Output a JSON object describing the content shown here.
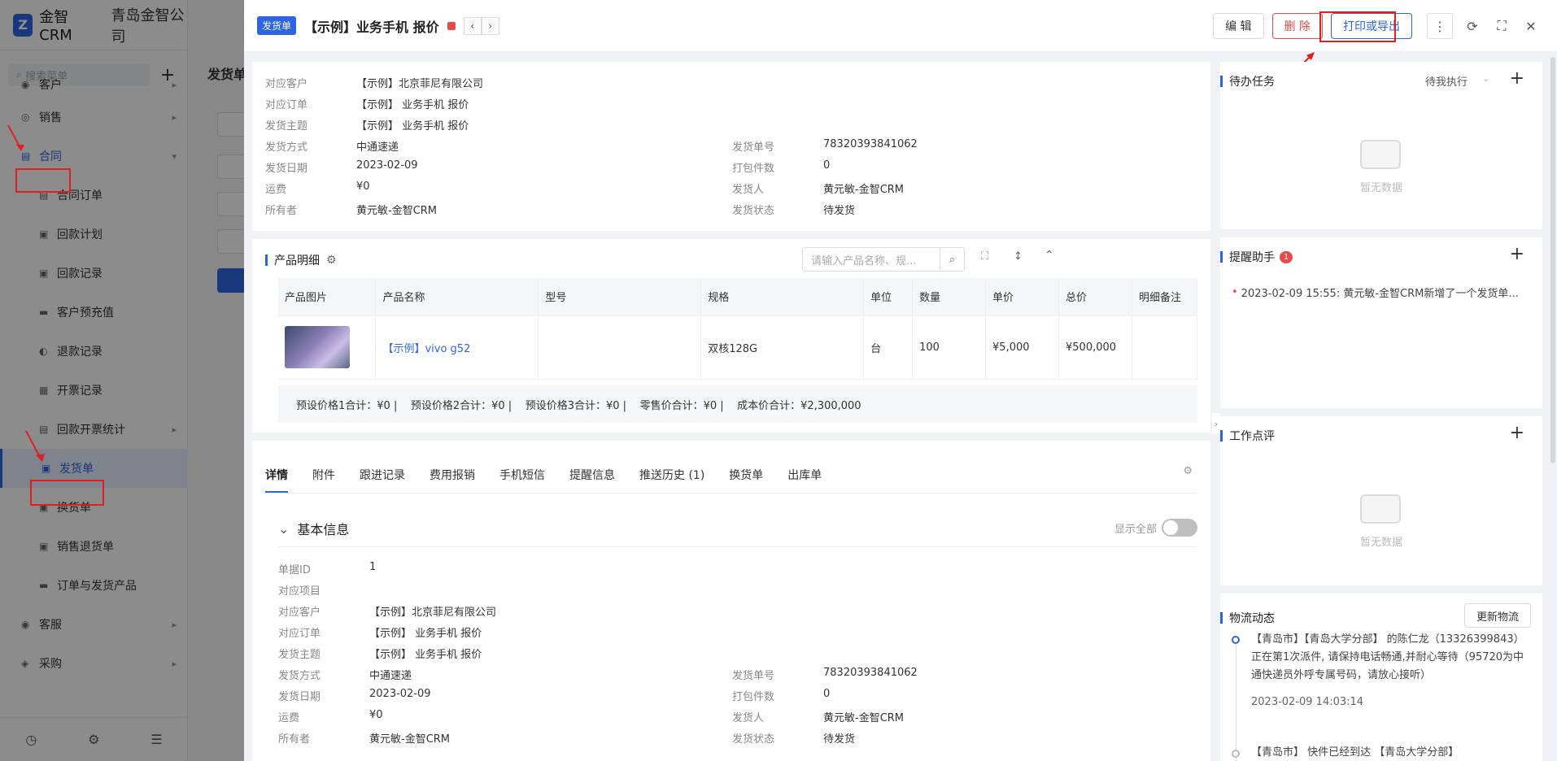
{
  "app": {
    "logo_text": "金智CRM",
    "logo_mark": "Z",
    "company": "青岛金智公司",
    "search_placeholder": "搜索菜单",
    "plus": "+",
    "bg_title": "发货单",
    "nav": [
      {
        "label": "客户"
      },
      {
        "label": "销售"
      },
      {
        "label": "合同"
      },
      {
        "label": "合同订单"
      },
      {
        "label": "回款计划"
      },
      {
        "label": "回款记录"
      },
      {
        "label": "客户预充值"
      },
      {
        "label": "退款记录"
      },
      {
        "label": "开票记录"
      },
      {
        "label": "回款开票统计"
      },
      {
        "label": "发货单"
      },
      {
        "label": "换货单"
      },
      {
        "label": "销售退货单"
      },
      {
        "label": "订单与发货产品"
      },
      {
        "label": "客服"
      },
      {
        "label": "采购"
      }
    ]
  },
  "drawer": {
    "tag": "发货单",
    "title": "【示例】业务手机 报价",
    "edit_label": "编 辑",
    "delete_label": "删 除",
    "print_label": "打印或导出",
    "summary": {
      "customer_label": "对应客户",
      "customer_value": "【示例】北京菲尼有限公司",
      "order_label": "对应订单",
      "order_value": "【示例】 业务手机 报价",
      "subject_label": "发货主题",
      "subject_value": "【示例】 业务手机 报价",
      "method_label": "发货方式",
      "method_value": "中通速递",
      "date_label": "发货日期",
      "date_value": "2023-02-09",
      "freight_label": "运费",
      "freight_value": "¥0",
      "owner_label": "所有者",
      "owner_value": "黄元敏-金智CRM",
      "no_label": "发货单号",
      "no_value": "78320393841062",
      "pack_label": "打包件数",
      "pack_value": "0",
      "shipper_label": "发货人",
      "shipper_value": "黄元敏-金智CRM",
      "status_label": "发货状态",
      "status_value": "待发货"
    },
    "products": {
      "title": "产品明细",
      "search_placeholder": "请输入产品名称、规...",
      "columns": [
        "产品图片",
        "产品名称",
        "型号",
        "规格",
        "单位",
        "数量",
        "单价",
        "总价",
        "明细备注"
      ],
      "rows": [
        {
          "name": "【示例】vivo g52",
          "model": "",
          "spec": "双核128G",
          "unit": "台",
          "qty": "100",
          "price": "¥5,000",
          "total": "¥500,000",
          "note": ""
        }
      ],
      "summary": "预设价格1合计：¥0 |    预设价格2合计：¥0 |    预设价格3合计：¥0 |    零售价合计：¥0 |    成本价合计：¥2,300,000"
    },
    "tabs": [
      "详情",
      "附件",
      "跟进记录",
      "费用报销",
      "手机短信",
      "提醒信息",
      "推送历史 (1)",
      "换货单",
      "出库单"
    ],
    "basic": {
      "title": "基本信息",
      "show_all": "显示全部",
      "id_label": "单据ID",
      "id_value": "1",
      "project_label": "对应项目",
      "project_value": ""
    },
    "todo": {
      "title": "待办任务",
      "filter": "待我执行",
      "empty": "暂无数据"
    },
    "reminder": {
      "title": "提醒助手",
      "badge": "1",
      "item": "2023-02-09 15:55: 黄元敏-金智CRM新增了一个发货单..."
    },
    "review": {
      "title": "工作点评",
      "empty": "暂无数据"
    },
    "logistics": {
      "title": "物流动态",
      "update_btn": "更新物流",
      "item1": "【青岛市】【青岛大学分部】 的陈仁龙（13326399843）正在第1次派件, 请保持电话畅通,并耐心等待（95720为中通快递员外呼专属号码，请放心接听）",
      "item1_time": "2023-02-09 14:03:14",
      "item2": "【青岛市】 快件已经到达 【青岛大学分部】"
    }
  }
}
